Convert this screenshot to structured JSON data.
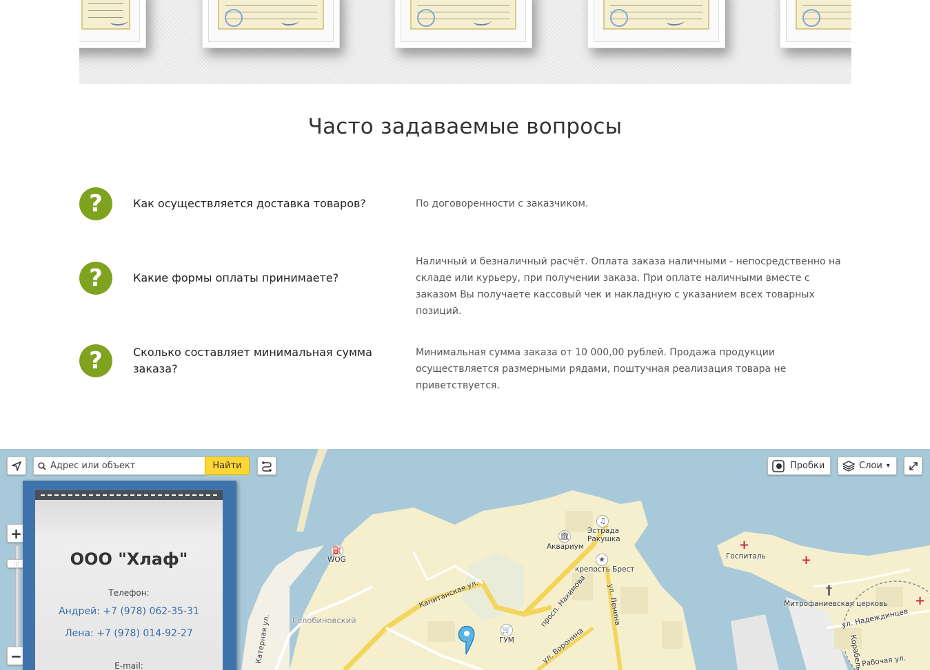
{
  "faq": {
    "title": "Часто задаваемые вопросы",
    "items": [
      {
        "question": "Как осуществляется доставка товаров?",
        "answer": "По договоренности с заказчиком."
      },
      {
        "question": "Какие формы оплаты принимаете?",
        "answer": "Наличный и безналичный расчёт. Оплата заказа наличными - непосредственно на складе или курьеру, при получении заказа. При оплате наличными вместе с заказом Вы получаете кассовый чек и накладную с указанием всех товарных позиций."
      },
      {
        "question": "Сколько составляет минимальная сумма заказа?",
        "answer": "Минимальная сумма заказа от 10 000,00 рублей. Продажа продукции осуществляется размерными рядами, поштучная реализация товара не приветствуется."
      }
    ],
    "icon_glyph": "?",
    "icon_color": "#7fa31f"
  },
  "map": {
    "search_placeholder": "Адрес или объект",
    "find_label": "Найти",
    "traffic_label": "Пробки",
    "layers_label": "Слои",
    "zoom_in": "+",
    "zoom_out": "−",
    "labels": {
      "kapitanskaya": "Капитанская ул.",
      "nakhimova": "просп. Нахимова",
      "lenina": "ул. Ленина",
      "voronina": "ул. Воронина",
      "katernaya": "Катерная ул.",
      "golobinovsky": "Голобиновский",
      "wog": "WOG",
      "akvarium": "Аквариум",
      "estrada": "Эстрада Ракушка",
      "brest": "крепость Брест",
      "gum": "ГУМ",
      "gospital": "Госпиталь",
      "church": "Митрофаниевская церковь",
      "nadezhdinets": "ул. Надеждинцев",
      "rabochaya": "Рабочая ул.",
      "korabel": "Корабель"
    }
  },
  "contact_card": {
    "company": "ООО \"Хлаф\"",
    "phone_label": "Телефон:",
    "phone_1": "Андрей:  +7 (978) 062-35-31",
    "phone_2": "Лена: +7 (978) 014-92-27",
    "email_label": "E-mail:"
  },
  "colors": {
    "accent_green": "#7fa31f",
    "card_blue": "#3f73ad",
    "find_button": "#ffd633",
    "sea": "#a8c9d9"
  }
}
